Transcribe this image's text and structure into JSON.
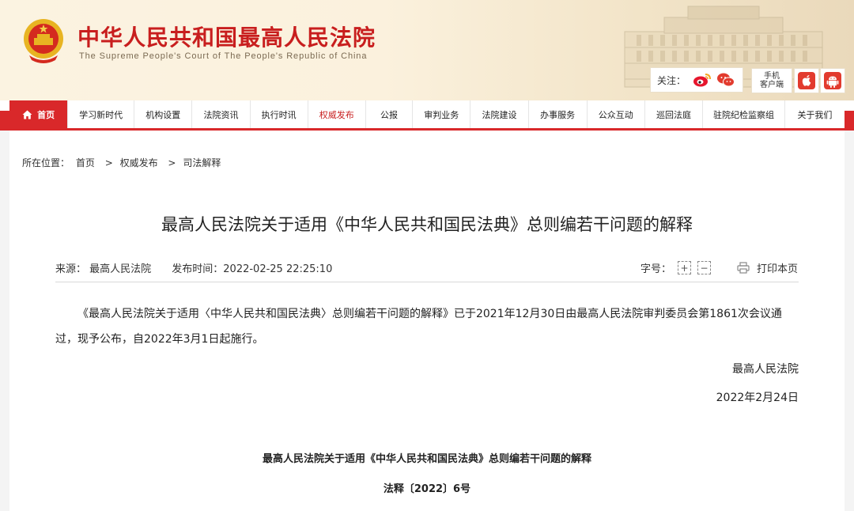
{
  "header": {
    "site_title": "中华人民共和国最高人民法院",
    "site_subtitle": "The Supreme People's Court of The People's Republic of China",
    "follow_label": "关注：",
    "client_label_1": "手机",
    "client_label_2": "客户端",
    "brand_color": "#d9282a"
  },
  "nav": {
    "items": [
      {
        "label": "首页",
        "active": true
      },
      {
        "label": "学习新时代"
      },
      {
        "label": "机构设置"
      },
      {
        "label": "法院资讯"
      },
      {
        "label": "执行时讯"
      },
      {
        "label": "权威发布",
        "highlight": true
      },
      {
        "label": "公报"
      },
      {
        "label": "审判业务"
      },
      {
        "label": "法院建设"
      },
      {
        "label": "办事服务"
      },
      {
        "label": "公众互动"
      },
      {
        "label": "巡回法庭"
      },
      {
        "label": "驻院纪检监察组"
      },
      {
        "label": "关于我们"
      }
    ]
  },
  "breadcrumb": {
    "prefix": "所在位置：",
    "items": [
      "首页",
      "权威发布",
      "司法解释"
    ],
    "separator": ">"
  },
  "article": {
    "title": "最高人民法院关于适用《中华人民共和国民法典》总则编若干问题的解释",
    "source": "来源：  最高人民法院",
    "publish_time": "发布时间：2022-02-25 22:25:10",
    "font_size_label": "字号：",
    "font_plus": "+",
    "font_minus": "−",
    "print_label": "打印本页",
    "paragraph_1": "《最高人民法院关于适用〈中华人民共和国民法典〉总则编若干问题的解释》已于2021年12月30日由最高人民法院审判委员会第1861次会议通过，现予公布，自2022年3月1日起施行。",
    "signer": "最高人民法院",
    "sign_date": "2022年2月24日",
    "doc_title": "最高人民法院关于适用《中华人民共和国民法典》总则编若干问题的解释",
    "doc_number": "法释〔2022〕6号"
  }
}
